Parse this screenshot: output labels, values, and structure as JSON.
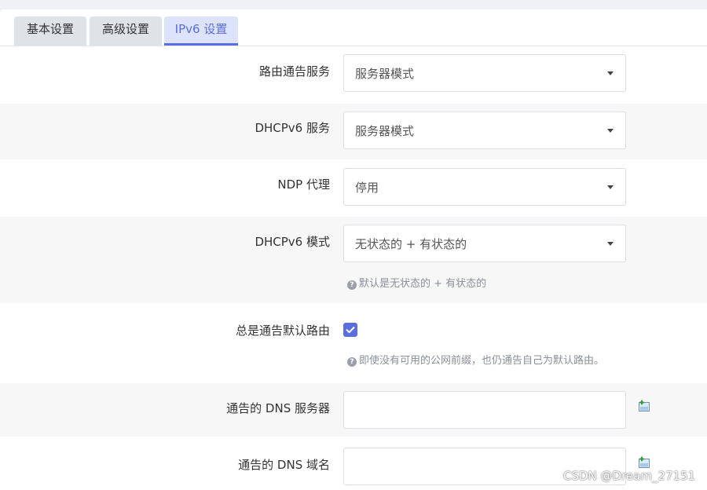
{
  "tabs": [
    {
      "label": "基本设置"
    },
    {
      "label": "高级设置"
    },
    {
      "label": "IPv6 设置"
    }
  ],
  "form": {
    "ra_service": {
      "label": "路由通告服务",
      "value": "服务器模式"
    },
    "dhcpv6_service": {
      "label": "DHCPv6 服务",
      "value": "服务器模式"
    },
    "ndp_proxy": {
      "label": "NDP 代理",
      "value": "停用"
    },
    "dhcpv6_mode": {
      "label": "DHCPv6 模式",
      "value": "无状态的 + 有状态的",
      "hint": "默认是无状态的 + 有状态的"
    },
    "default_route": {
      "label": "总是通告默认路由",
      "checked": true,
      "hint": "即使没有可用的公网前缀，也仍通告自己为默认路由。"
    },
    "dns_servers": {
      "label": "通告的 DNS 服务器",
      "value": "",
      "add_icon": "add-entry-icon"
    },
    "dns_domains": {
      "label": "通告的 DNS 域名",
      "value": "",
      "add_icon": "add-entry-icon"
    }
  },
  "colors": {
    "accent": "#5b6ee0",
    "tab_active_bg": "#dde3fb",
    "row_shade": "#f7f7f8"
  },
  "watermark": "CSDN @Dream_27151"
}
